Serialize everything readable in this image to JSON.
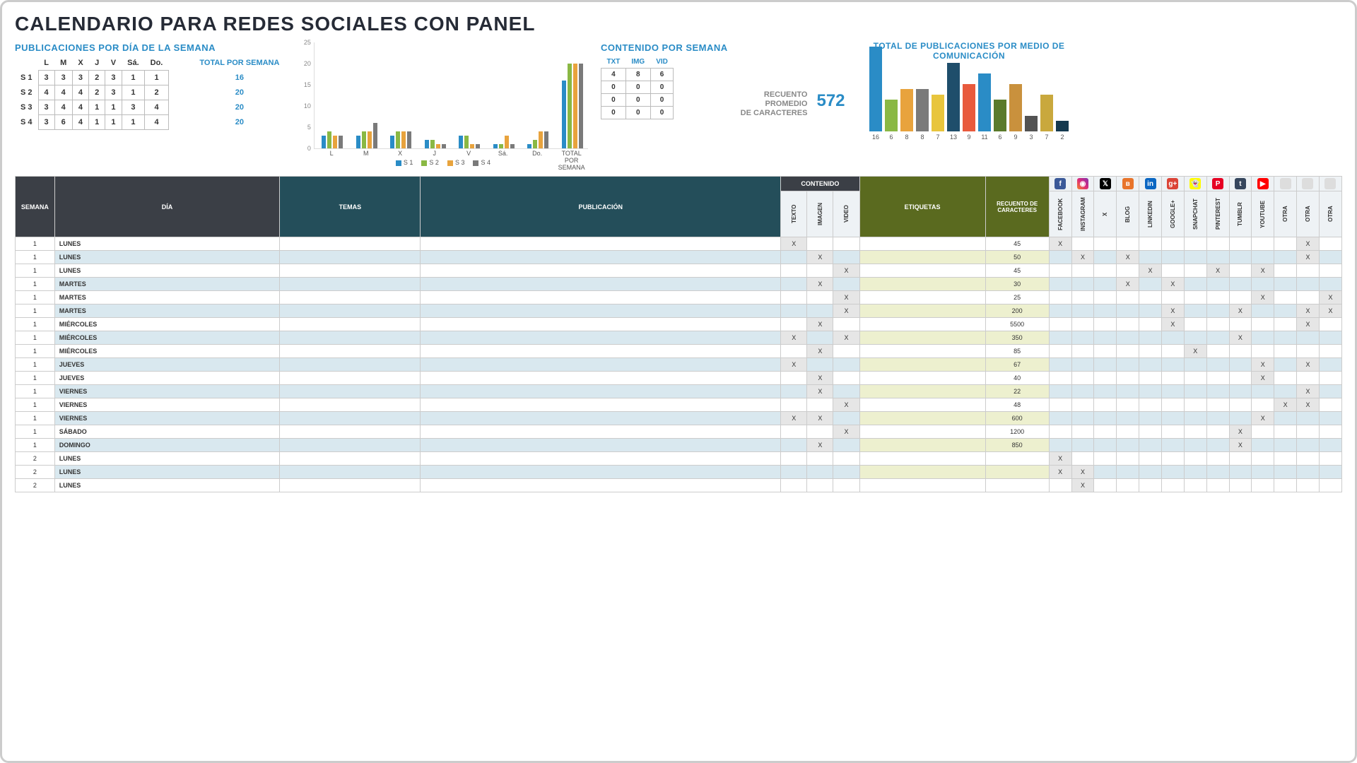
{
  "title": "CALENDARIO PARA REDES SOCIALES CON PANEL",
  "pub_title": "PUBLICACIONES POR DÍA DE LA SEMANA",
  "days": [
    "L",
    "M",
    "X",
    "J",
    "V",
    "Sá.",
    "Do."
  ],
  "tot_hdr": "TOTAL POR SEMANA",
  "weeks": [
    {
      "lbl": "S 1",
      "vals": [
        3,
        3,
        3,
        2,
        3,
        1,
        1
      ],
      "tot": 16
    },
    {
      "lbl": "S 2",
      "vals": [
        4,
        4,
        4,
        2,
        3,
        1,
        2
      ],
      "tot": 20
    },
    {
      "lbl": "S 3",
      "vals": [
        3,
        4,
        4,
        1,
        1,
        3,
        4
      ],
      "tot": 20
    },
    {
      "lbl": "S 4",
      "vals": [
        3,
        6,
        4,
        1,
        1,
        1,
        4
      ],
      "tot": 20
    }
  ],
  "chart_data": {
    "type": "bar",
    "title": "",
    "ylim": [
      0,
      25
    ],
    "yticks": [
      0,
      5,
      10,
      15,
      20,
      25
    ],
    "categories": [
      "L",
      "M",
      "X",
      "J",
      "V",
      "Sá.",
      "Do.",
      "TOTAL POR SEMANA"
    ],
    "series": [
      {
        "name": "S 1",
        "values": [
          3,
          3,
          3,
          2,
          3,
          1,
          1,
          16
        ]
      },
      {
        "name": "S 2",
        "values": [
          4,
          4,
          4,
          2,
          3,
          1,
          2,
          20
        ]
      },
      {
        "name": "S 3",
        "values": [
          3,
          4,
          4,
          1,
          1,
          3,
          4,
          20
        ]
      },
      {
        "name": "S 4",
        "values": [
          3,
          6,
          4,
          1,
          1,
          1,
          4,
          20
        ]
      }
    ]
  },
  "cont_title": "CONTENIDO POR SEMANA",
  "cont_hdrs": [
    "TXT",
    "IMG",
    "VID"
  ],
  "cont_rows": [
    [
      4,
      8,
      6
    ],
    [
      0,
      0,
      0
    ],
    [
      0,
      0,
      0
    ],
    [
      0,
      0,
      0
    ]
  ],
  "avg_lbl1": "RECUENTO",
  "avg_lbl2": "PROMEDIO",
  "avg_lbl3": "DE CARACTERES",
  "avg_val": "572",
  "chart2_title": "TOTAL DE PUBLICACIONES POR MEDIO DE COMUNICACIÓN",
  "chart2_data": {
    "type": "bar",
    "ylim": [
      0,
      16
    ],
    "values": [
      16,
      6,
      8,
      8,
      7,
      13,
      9,
      11,
      6,
      9,
      3,
      7,
      2
    ]
  },
  "table": {
    "h_semana": "SEMANA",
    "h_dia": "DÍA",
    "h_temas": "TEMAS",
    "h_pub": "PUBLICACIÓN",
    "h_cont": "CONTENIDO",
    "h_txt": "TEXTO",
    "h_img": "IMAGEN",
    "h_vid": "VIDEO",
    "h_et": "ETIQUETAS",
    "h_rec": "RECUENTO DE CARACTERES",
    "channels": [
      "FACEBOOK",
      "INSTAGRAM",
      "X",
      "BLOG",
      "LINKEDIN",
      "GOOGLE+",
      "SNAPCHAT",
      "PINTEREST",
      "TUMBLR",
      "YOUTUBE",
      "OTRA",
      "OTRA",
      "OTRA"
    ],
    "icons": [
      {
        "bg": "#3b5998",
        "t": "f"
      },
      {
        "bg": "linear-gradient(45deg,#f58529,#dd2a7b,#8134af)",
        "t": "◉"
      },
      {
        "bg": "#000",
        "t": "𝕏"
      },
      {
        "bg": "#e8742b",
        "t": "ʙ"
      },
      {
        "bg": "#0a66c2",
        "t": "in"
      },
      {
        "bg": "#db4437",
        "t": "g+"
      },
      {
        "bg": "#fffc00",
        "t": "👻"
      },
      {
        "bg": "#e60023",
        "t": "P"
      },
      {
        "bg": "#36465d",
        "t": "t"
      },
      {
        "bg": "#ff0000",
        "t": "▶"
      },
      {
        "bg": "#ddd",
        "t": ""
      },
      {
        "bg": "#ddd",
        "t": ""
      },
      {
        "bg": "#ddd",
        "t": ""
      }
    ],
    "rows": [
      {
        "s": 1,
        "d": "LUNES",
        "even": 0,
        "txt": "X",
        "img": "",
        "vid": "",
        "rec": "45",
        "ch": [
          "X",
          "",
          "",
          "",
          "",
          "",
          "",
          "",
          "",
          "",
          "",
          "X",
          ""
        ]
      },
      {
        "s": 1,
        "d": "LUNES",
        "even": 1,
        "txt": "",
        "img": "X",
        "vid": "",
        "rec": "50",
        "ch": [
          "",
          "X",
          "",
          "X",
          "",
          "",
          "",
          "",
          "",
          "",
          "",
          "X",
          ""
        ]
      },
      {
        "s": 1,
        "d": "LUNES",
        "even": 0,
        "txt": "",
        "img": "",
        "vid": "X",
        "rec": "45",
        "ch": [
          "",
          "",
          "",
          "",
          "X",
          "",
          "",
          "X",
          "",
          "X",
          "",
          "",
          ""
        ]
      },
      {
        "s": 1,
        "d": "MARTES",
        "even": 1,
        "txt": "",
        "img": "X",
        "vid": "",
        "rec": "30",
        "ch": [
          "",
          "",
          "",
          "X",
          "",
          "X",
          "",
          "",
          "",
          "",
          "",
          "",
          ""
        ]
      },
      {
        "s": 1,
        "d": "MARTES",
        "even": 0,
        "txt": "",
        "img": "",
        "vid": "X",
        "rec": "25",
        "ch": [
          "",
          "",
          "",
          "",
          "",
          "",
          "",
          "",
          "",
          "X",
          "",
          "",
          "X"
        ]
      },
      {
        "s": 1,
        "d": "MARTES",
        "even": 1,
        "txt": "",
        "img": "",
        "vid": "X",
        "rec": "200",
        "ch": [
          "",
          "",
          "",
          "",
          "",
          "X",
          "",
          "",
          "X",
          "",
          "",
          "X",
          "X"
        ]
      },
      {
        "s": 1,
        "d": "MIÉRCOLES",
        "even": 0,
        "txt": "",
        "img": "X",
        "vid": "",
        "rec": "5500",
        "ch": [
          "",
          "",
          "",
          "",
          "",
          "X",
          "",
          "",
          "",
          "",
          "",
          "X",
          ""
        ]
      },
      {
        "s": 1,
        "d": "MIÉRCOLES",
        "even": 1,
        "txt": "X",
        "img": "",
        "vid": "X",
        "rec": "350",
        "ch": [
          "",
          "",
          "",
          "",
          "",
          "",
          "",
          "",
          "X",
          "",
          "",
          "",
          ""
        ]
      },
      {
        "s": 1,
        "d": "MIÉRCOLES",
        "even": 0,
        "txt": "",
        "img": "X",
        "vid": "",
        "rec": "85",
        "ch": [
          "",
          "",
          "",
          "",
          "",
          "",
          "X",
          "",
          "",
          "",
          "",
          "",
          ""
        ]
      },
      {
        "s": 1,
        "d": "JUEVES",
        "even": 1,
        "txt": "X",
        "img": "",
        "vid": "",
        "rec": "67",
        "ch": [
          "",
          "",
          "",
          "",
          "",
          "",
          "",
          "",
          "",
          "X",
          "",
          "X",
          ""
        ]
      },
      {
        "s": 1,
        "d": "JUEVES",
        "even": 0,
        "txt": "",
        "img": "X",
        "vid": "",
        "rec": "40",
        "ch": [
          "",
          "",
          "",
          "",
          "",
          "",
          "",
          "",
          "",
          "X",
          "",
          "",
          ""
        ]
      },
      {
        "s": 1,
        "d": "VIERNES",
        "even": 1,
        "txt": "",
        "img": "X",
        "vid": "",
        "rec": "22",
        "ch": [
          "",
          "",
          "",
          "",
          "",
          "",
          "",
          "",
          "",
          "",
          "",
          "X",
          ""
        ]
      },
      {
        "s": 1,
        "d": "VIERNES",
        "even": 0,
        "txt": "",
        "img": "",
        "vid": "X",
        "rec": "48",
        "ch": [
          "",
          "",
          "",
          "",
          "",
          "",
          "",
          "",
          "",
          "",
          "X",
          "X",
          ""
        ]
      },
      {
        "s": 1,
        "d": "VIERNES",
        "even": 1,
        "txt": "X",
        "img": "X",
        "vid": "",
        "rec": "600",
        "ch": [
          "",
          "",
          "",
          "",
          "",
          "",
          "",
          "",
          "",
          "X",
          "",
          "",
          ""
        ]
      },
      {
        "s": 1,
        "d": "SÁBADO",
        "even": 0,
        "txt": "",
        "img": "",
        "vid": "X",
        "rec": "1200",
        "ch": [
          "",
          "",
          "",
          "",
          "",
          "",
          "",
          "",
          "X",
          "",
          "",
          "",
          ""
        ]
      },
      {
        "s": 1,
        "d": "DOMINGO",
        "even": 1,
        "txt": "",
        "img": "X",
        "vid": "",
        "rec": "850",
        "ch": [
          "",
          "",
          "",
          "",
          "",
          "",
          "",
          "",
          "X",
          "",
          "",
          "",
          ""
        ]
      },
      {
        "s": 2,
        "d": "LUNES",
        "even": 0,
        "txt": "",
        "img": "",
        "vid": "",
        "rec": "",
        "ch": [
          "X",
          "",
          "",
          "",
          "",
          "",
          "",
          "",
          "",
          "",
          "",
          "",
          ""
        ]
      },
      {
        "s": 2,
        "d": "LUNES",
        "even": 1,
        "txt": "",
        "img": "",
        "vid": "",
        "rec": "",
        "ch": [
          "X",
          "X",
          "",
          "",
          "",
          "",
          "",
          "",
          "",
          "",
          "",
          "",
          ""
        ]
      },
      {
        "s": 2,
        "d": "LUNES",
        "even": 0,
        "txt": "",
        "img": "",
        "vid": "",
        "rec": "",
        "ch": [
          "",
          "X",
          "",
          "",
          "",
          "",
          "",
          "",
          "",
          "",
          "",
          "",
          ""
        ]
      }
    ]
  }
}
